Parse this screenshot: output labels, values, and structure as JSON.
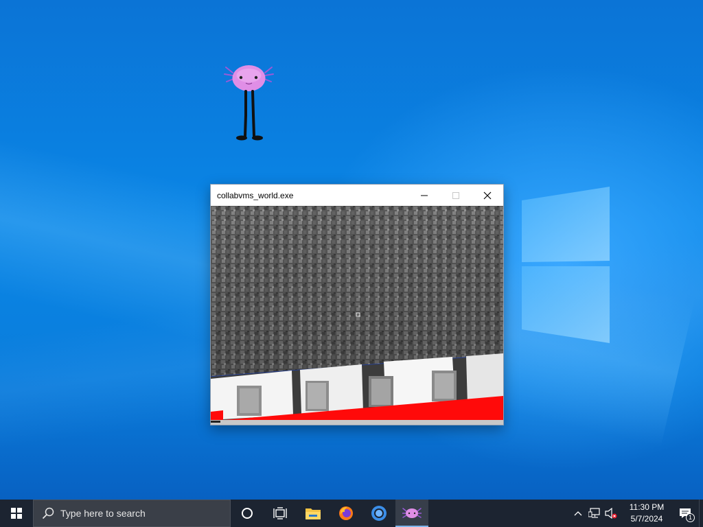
{
  "window": {
    "title": "collabvms_world.exe",
    "buttons": [
      "minimize",
      "maximize",
      "close"
    ]
  },
  "taskbar": {
    "search_placeholder": "Type here to search",
    "pinned": [
      {
        "name": "cortana",
        "icon": "circle-icon"
      },
      {
        "name": "task-view",
        "icon": "task-view-icon"
      },
      {
        "name": "file-explorer",
        "icon": "folder-icon"
      },
      {
        "name": "firefox",
        "icon": "firefox-icon"
      },
      {
        "name": "chrome",
        "icon": "chrome-icon"
      },
      {
        "name": "collabvms-world",
        "icon": "axolotl-icon",
        "active": true
      }
    ],
    "tray": {
      "time": "11:30 PM",
      "date": "5/7/2024",
      "notification_count": "1"
    }
  },
  "colors": {
    "taskbar_bg": "#1c2431",
    "wallpaper_blue": "#0a7ddc",
    "pet_pink": "#e08ee6",
    "accent": "#7fb6ec"
  }
}
